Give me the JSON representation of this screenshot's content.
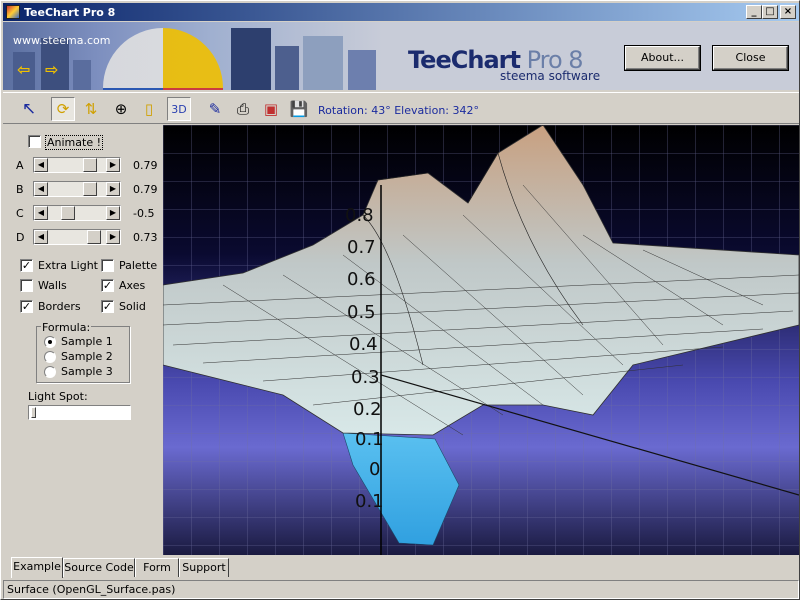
{
  "window": {
    "title": "TeeChart Pro 8",
    "controls": {
      "minimize": "_",
      "maximize": "□",
      "close": "×"
    }
  },
  "banner": {
    "url": "www.steema.com",
    "back_icon": "arrow-left-icon",
    "forward_icon": "arrow-right-icon",
    "logo_main": "TeeChart",
    "logo_pro": " Pro 8",
    "logo_sub": "steema software",
    "about_label": "About...",
    "close_label": "Close"
  },
  "toolbar": {
    "items": [
      "pointer-icon",
      "rotate-icon",
      "move-icon",
      "zoom-icon",
      "depth-icon",
      "3d-toggle-icon",
      "edit-chart-icon",
      "print-icon",
      "export-icon",
      "save-icon"
    ],
    "threed_label": "3D",
    "rotation_text": "Rotation: 43° Elevation: 342°"
  },
  "controls": {
    "animate_label": "Animate !",
    "animate_checked": false,
    "sliders": [
      {
        "name": "A",
        "value": "0.79",
        "position": 0.79
      },
      {
        "name": "B",
        "value": "0.79",
        "position": 0.79
      },
      {
        "name": "C",
        "value": "-0.5",
        "position": 0.4
      },
      {
        "name": "D",
        "value": "0.73",
        "position": 0.73
      }
    ],
    "checkboxes": [
      {
        "label": "Extra Light",
        "checked": true
      },
      {
        "label": "Palette",
        "checked": false
      },
      {
        "label": "Walls",
        "checked": false
      },
      {
        "label": "Axes",
        "checked": true
      },
      {
        "label": "Borders",
        "checked": true
      },
      {
        "label": "Solid",
        "checked": true
      }
    ],
    "formula_title": "Formula:",
    "formulas": [
      {
        "label": "Sample 1",
        "selected": true
      },
      {
        "label": "Sample 2",
        "selected": false
      },
      {
        "label": "Sample 3",
        "selected": false
      }
    ],
    "light_spot_label": "Light Spot:"
  },
  "chart_data": {
    "type": "surface",
    "zaxis_labels": [
      "0.8",
      "0.7",
      "0.6",
      "0.5",
      "0.4",
      "0.3",
      "0.2",
      "0.1",
      "0",
      "0.1"
    ],
    "peaks": [
      0.9,
      0.95
    ],
    "trough": -0.3
  },
  "tabs": [
    "Example",
    "Source Code",
    "Form",
    "Support"
  ],
  "active_tab": "Example",
  "status": "Surface (OpenGL_Surface.pas)"
}
